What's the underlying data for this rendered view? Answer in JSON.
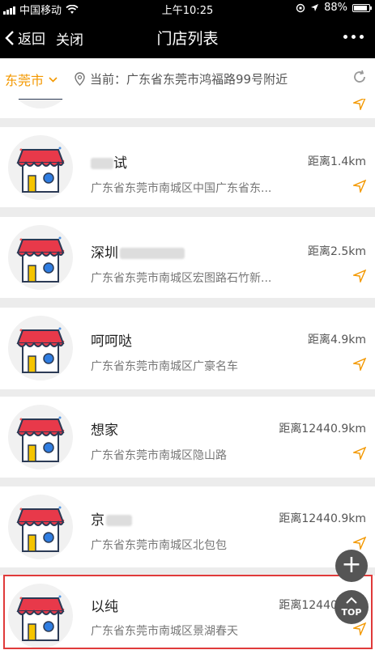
{
  "status_bar": {
    "carrier": "中国移动",
    "time": "上午10:25",
    "battery": "88%"
  },
  "nav": {
    "back_label": "返回",
    "close_label": "关闭",
    "title": "门店列表"
  },
  "location": {
    "city": "东莞市",
    "current": "当前：广东省东莞市鸿福路99号附近"
  },
  "stores": [
    {
      "name": "试",
      "distance": "距离1.4km",
      "address": "广东省东莞市南城区中国广东省东..."
    },
    {
      "name": "深圳",
      "distance": "距离2.5km",
      "address": "广东省东莞市南城区宏图路石竹新..."
    },
    {
      "name": "呵呵哒",
      "distance": "距离4.9km",
      "address": "广东省东莞市南城区广豪名车"
    },
    {
      "name": "想家",
      "distance": "距离12440.9km",
      "address": "广东省东莞市南城区隐山路"
    },
    {
      "name": "京",
      "distance": "距离12440.9km",
      "address": "广东省东莞市南城区北包包"
    },
    {
      "name": "以纯",
      "distance": "距离12440.9km",
      "address": "广东省东莞市南城区景湖春天"
    }
  ],
  "fab": {
    "top_label": "TOP",
    "add_label": "+"
  },
  "colors": {
    "accent": "#f39800",
    "highlight": "#e03a3a"
  }
}
